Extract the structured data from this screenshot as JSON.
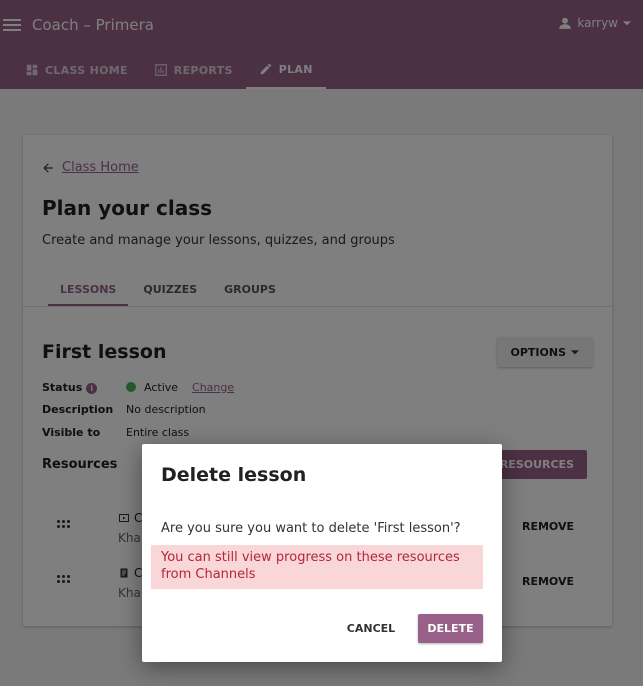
{
  "appbar": {
    "title": "Coach – Primera",
    "username": "karryw",
    "tabs": [
      {
        "label": "CLASS HOME",
        "icon": "dashboard-icon"
      },
      {
        "label": "REPORTS",
        "icon": "bar-chart-icon"
      },
      {
        "label": "PLAN",
        "icon": "pencil-icon",
        "active": true
      }
    ]
  },
  "page": {
    "back_label": "Class Home",
    "title": "Plan your class",
    "subtitle": "Create and manage your lessons, quizzes, and groups",
    "subtabs": [
      "LESSONS",
      "QUIZZES",
      "GROUPS"
    ]
  },
  "lesson": {
    "title": "First lesson",
    "options_label": "OPTIONS",
    "status_key": "Status",
    "status_value": "Active",
    "change_label": "Change",
    "description_key": "Description",
    "description_value": "No description",
    "visible_key": "Visible to",
    "visible_value": "Entire class",
    "resources_title": "Resources",
    "manage_label": "E RESOURCES",
    "resources": [
      {
        "name": "C",
        "channel": "Kha",
        "icon": "video-icon",
        "remove": "REMOVE"
      },
      {
        "name": "C",
        "channel": "Kha",
        "icon": "exercise-icon",
        "remove": "REMOVE"
      }
    ]
  },
  "dialog": {
    "title": "Delete lesson",
    "message": "Are you sure you want to delete 'First lesson'?",
    "warning": "You can still view progress on these resources from Channels",
    "cancel_label": "CANCEL",
    "delete_label": "DELETE"
  },
  "colors": {
    "brand": "#996189",
    "status_active": "#4caf50",
    "warning_bg": "#f9d6d8",
    "warning_text": "#b3263a"
  }
}
